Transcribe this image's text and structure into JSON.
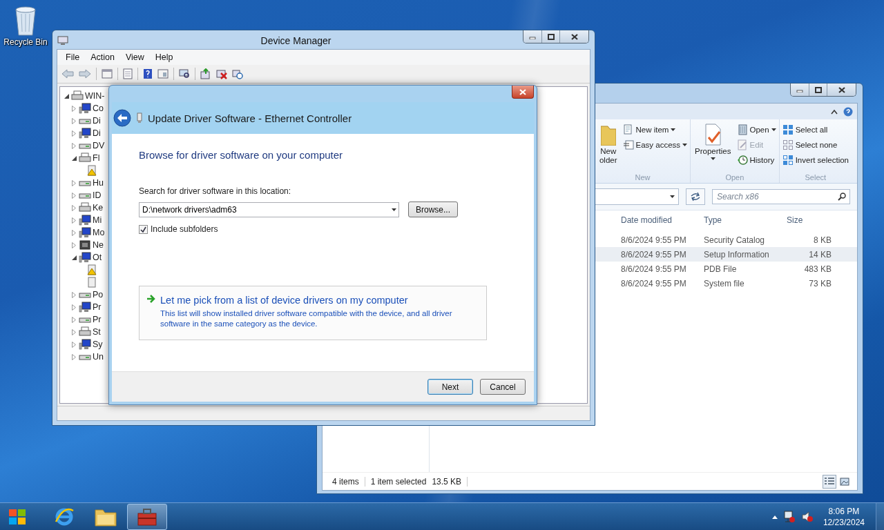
{
  "desktop": {
    "icons": [
      {
        "label": "Recycle Bin"
      }
    ]
  },
  "explorer": {
    "ribbon": {
      "groups": [
        {
          "label": "New",
          "big": {
            "label": "New\nolder",
            "dropdown": false
          },
          "items": [
            {
              "label": "New item",
              "dropdown": true,
              "disabled": false
            },
            {
              "label": "Easy access",
              "dropdown": true,
              "disabled": false
            }
          ]
        },
        {
          "label": "Open",
          "big": {
            "label": "Properties",
            "dropdown": true
          },
          "items": [
            {
              "label": "Open",
              "dropdown": true,
              "disabled": false
            },
            {
              "label": "Edit",
              "dropdown": false,
              "disabled": true
            },
            {
              "label": "History",
              "dropdown": false,
              "disabled": false
            }
          ]
        },
        {
          "label": "Select",
          "items": [
            {
              "label": "Select all",
              "dropdown": false,
              "disabled": false
            },
            {
              "label": "Select none",
              "dropdown": false,
              "disabled": false
            },
            {
              "label": "Invert selection",
              "dropdown": false,
              "disabled": false
            }
          ]
        }
      ]
    },
    "search": {
      "placeholder": "Search x86"
    },
    "columns": [
      "Date modified",
      "Type",
      "Size"
    ],
    "rows": [
      {
        "date": "8/6/2024 9:55 PM",
        "type": "Security Catalog",
        "size": "8 KB",
        "selected": false
      },
      {
        "date": "8/6/2024 9:55 PM",
        "type": "Setup Information",
        "size": "14 KB",
        "selected": true
      },
      {
        "date": "8/6/2024 9:55 PM",
        "type": "PDB File",
        "size": "483 KB",
        "selected": false
      },
      {
        "date": "8/6/2024 9:55 PM",
        "type": "System file",
        "size": "73 KB",
        "selected": false
      }
    ],
    "status": {
      "count": "4 items",
      "selection": "1 item selected",
      "size": "13.5 KB"
    },
    "views": [
      {
        "selected": true
      },
      {
        "selected": false
      }
    ]
  },
  "device_manager": {
    "title": "Device Manager",
    "menu": [
      "File",
      "Action",
      "View",
      "Help"
    ],
    "tree": [
      {
        "label": "WIN-",
        "expanded": true,
        "children": [
          {
            "label": "Co",
            "expanded": false
          },
          {
            "label": "Di",
            "expanded": false
          },
          {
            "label": "Di",
            "expanded": false
          },
          {
            "label": "DV",
            "expanded": false
          },
          {
            "label": "Fl",
            "expanded": true,
            "children": [
              {
                "warning": true
              }
            ]
          },
          {
            "label": "Hu",
            "expanded": false
          },
          {
            "label": "ID",
            "expanded": false
          },
          {
            "label": "Ke",
            "expanded": false
          },
          {
            "label": "Mi",
            "expanded": false
          },
          {
            "label": "Mo",
            "expanded": false
          },
          {
            "label": "Ne",
            "expanded": false
          },
          {
            "label": "Ot",
            "expanded": true,
            "children": [
              {
                "warning": true
              },
              {
                "warning": false
              }
            ]
          },
          {
            "label": "Po",
            "expanded": false
          },
          {
            "label": "Pr",
            "expanded": false
          },
          {
            "label": "Pr",
            "expanded": false
          },
          {
            "label": "St",
            "expanded": false
          },
          {
            "label": "Sy",
            "expanded": false
          },
          {
            "label": "Un",
            "expanded": false
          }
        ]
      }
    ]
  },
  "dialog": {
    "title": "Update Driver Software - Ethernet Controller",
    "heading": "Browse for driver software on your computer",
    "location_label": "Search for driver software in this location:",
    "location": "D:\\network drivers\\adm63",
    "browse": "Browse...",
    "checkbox": {
      "label": "Include subfolders",
      "checked": true
    },
    "option": {
      "link": "Let me pick from a list of device drivers on my computer",
      "description": "This list will show installed driver software compatible with the device, and all driver software in the same category as the device."
    },
    "buttons": [
      {
        "label": "Next",
        "default": true
      },
      {
        "label": "Cancel",
        "default": false
      }
    ]
  },
  "taskbar": {
    "apps": [
      {
        "kind": "browser",
        "selected": false
      },
      {
        "kind": "folder",
        "selected": false
      },
      {
        "kind": "toolbox",
        "selected": true
      }
    ],
    "clock": {
      "time": "8:06 PM",
      "date": "12/23/2024"
    }
  }
}
